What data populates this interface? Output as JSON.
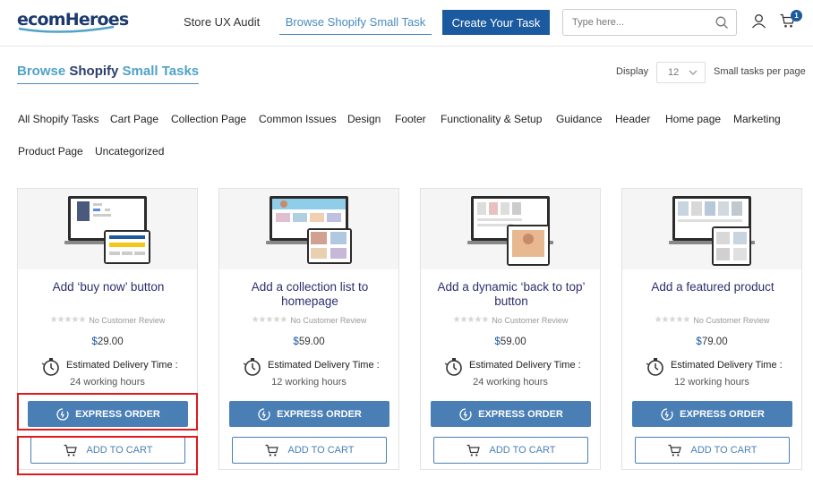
{
  "header": {
    "logo_text": "ecomHeroes",
    "nav_audit": "Store UX Audit",
    "nav_browse": "Browse Shopify Small Task",
    "create_button": "Create Your Task",
    "search_placeholder": "Type here...",
    "cart_count": "1"
  },
  "page": {
    "title_part1": "Browse",
    "title_part2": "Shopify",
    "title_part3": "Small Tasks",
    "display_label": "Display",
    "display_value": "12",
    "per_page_label": "Small tasks per page"
  },
  "categories": [
    "All Shopify Tasks",
    "Cart Page",
    "Collection Page",
    "Common Issues",
    "Design",
    "Footer",
    "Functionality & Setup",
    "Guidance",
    "Header",
    "Home page",
    "Marketing",
    "Product Page",
    "Uncategorized"
  ],
  "cards": [
    {
      "title": "Add ‘buy now’ button",
      "review": "No Customer Review",
      "currency": "$",
      "price": "29.00",
      "delivery_label": "Estimated Delivery Time :",
      "delivery_time": "24 working hours",
      "express_label": "EXPRESS ORDER",
      "cart_label": "ADD TO CART"
    },
    {
      "title": "Add a collection list to homepage",
      "review": "No Customer Review",
      "currency": "$",
      "price": "59.00",
      "delivery_label": "Estimated Delivery Time :",
      "delivery_time": "12 working hours",
      "express_label": "EXPRESS ORDER",
      "cart_label": "ADD TO CART"
    },
    {
      "title": "Add a dynamic ‘back to top’ button",
      "review": "No Customer Review",
      "currency": "$",
      "price": "59.00",
      "delivery_label": "Estimated Delivery Time :",
      "delivery_time": "24 working hours",
      "express_label": "EXPRESS ORDER",
      "cart_label": "ADD TO CART"
    },
    {
      "title": "Add a featured product",
      "review": "No Customer Review",
      "currency": "$",
      "price": "79.00",
      "delivery_label": "Estimated Delivery Time :",
      "delivery_time": "12 working hours",
      "express_label": "EXPRESS ORDER",
      "cart_label": "ADD TO CART"
    }
  ],
  "colors": {
    "brand": "#1c5aa0",
    "button": "#4a7fb5",
    "highlight": "#e0191f"
  }
}
